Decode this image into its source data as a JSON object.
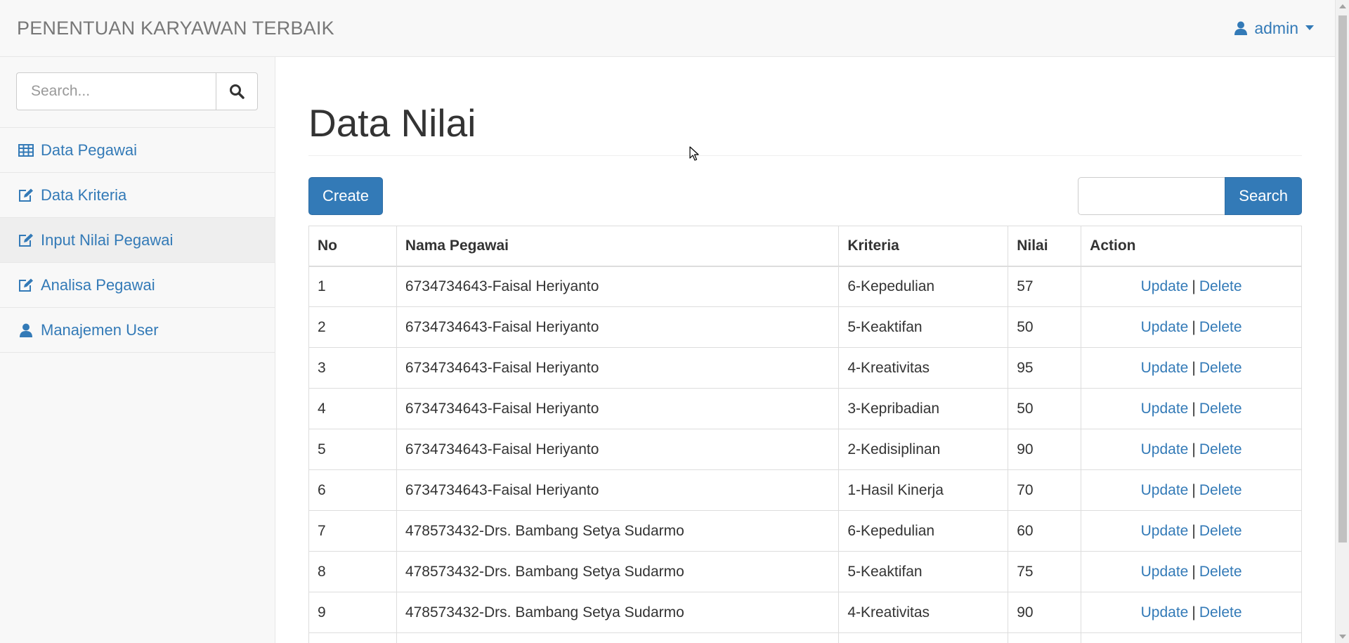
{
  "navbar": {
    "brand": "PENENTUAN KARYAWAN TERBAIK",
    "user": "admin"
  },
  "sidebar": {
    "search_placeholder": "Search...",
    "items": [
      {
        "label": "Data Pegawai",
        "icon": "table-icon"
      },
      {
        "label": "Data Kriteria",
        "icon": "edit-icon"
      },
      {
        "label": "Input Nilai Pegawai",
        "icon": "edit-icon",
        "active": true
      },
      {
        "label": "Analisa Pegawai",
        "icon": "edit-icon"
      },
      {
        "label": "Manajemen User",
        "icon": "user-icon"
      }
    ]
  },
  "main": {
    "title": "Data Nilai",
    "create_label": "Create",
    "search_label": "Search",
    "search_value": ""
  },
  "table": {
    "headers": [
      "No",
      "Nama Pegawai",
      "Kriteria",
      "Nilai",
      "Action"
    ],
    "update_label": "Update",
    "delete_label": "Delete",
    "separator": "|",
    "rows": [
      [
        "1",
        "6734734643-Faisal Heriyanto",
        "6-Kepedulian",
        "57"
      ],
      [
        "2",
        "6734734643-Faisal Heriyanto",
        "5-Keaktifan",
        "50"
      ],
      [
        "3",
        "6734734643-Faisal Heriyanto",
        "4-Kreativitas",
        "95"
      ],
      [
        "4",
        "6734734643-Faisal Heriyanto",
        "3-Kepribadian",
        "50"
      ],
      [
        "5",
        "6734734643-Faisal Heriyanto",
        "2-Kedisiplinan",
        "90"
      ],
      [
        "6",
        "6734734643-Faisal Heriyanto",
        "1-Hasil Kinerja",
        "70"
      ],
      [
        "7",
        "478573432-Drs. Bambang Setya Sudarmo",
        "6-Kepedulian",
        "60"
      ],
      [
        "8",
        "478573432-Drs. Bambang Setya Sudarmo",
        "5-Keaktifan",
        "75"
      ],
      [
        "9",
        "478573432-Drs. Bambang Setya Sudarmo",
        "4-Kreativitas",
        "90"
      ],
      [
        "",
        "",
        "",
        ""
      ]
    ]
  },
  "colors": {
    "primary": "#337ab7",
    "navbar_bg": "#f8f8f8",
    "active_item_bg": "#eeeeee"
  }
}
